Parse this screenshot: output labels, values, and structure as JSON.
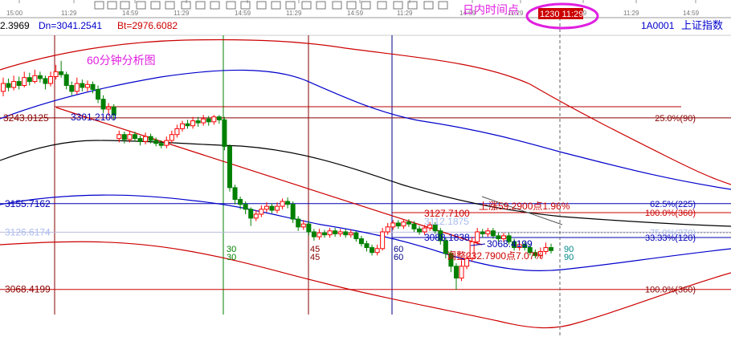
{
  "toolbar": {
    "time_labels": [
      "15:00",
      "11:29",
      "14:59",
      "11:29",
      "14:59",
      "11:29",
      "14:59",
      "11:29",
      "14:59",
      "11:29",
      "14:59",
      "11:29",
      "14:59"
    ],
    "intraday_label": "日内时间点",
    "cursor_time": "1230 11:29"
  },
  "header": {
    "indicator_text": "2.3969",
    "dn_text": "Dn=3041.2541",
    "bt_text": "Bt=2976.6082",
    "symbol_code": "1A0001",
    "symbol_name": "上证指数"
  },
  "chart_title": "60分钟分析图",
  "colors": {
    "up": "#ff0000",
    "down": "#008000",
    "outer_band": "#cc0000",
    "inner_band": "#0000cc",
    "mid_band": "#000000",
    "trendline": "#cc0000",
    "level_red": "#b40000",
    "level_blue": "#0000b4",
    "highlight": "#e020e0"
  },
  "chart_data": {
    "type": "candlestick",
    "title": "60分钟分析图",
    "symbol": "上证指数",
    "ylim": [
      3020,
      3345
    ],
    "price_labels": {
      "high": "3301.2100",
      "low_a": "3088.1838",
      "low_b": "3068.4199",
      "mid": "3127.7100",
      "mid2": "3112.1875"
    },
    "levels": [
      {
        "name": "3243.0125",
        "value": 3243.0125,
        "label": "25.0%(90)",
        "color": "red"
      },
      {
        "name": "3155.7162",
        "value": 3155.7162,
        "label": "62.5%(225)",
        "color": "blue"
      },
      {
        "name": "3126.6174",
        "value": 3126.6174,
        "label": "75.0%(270)",
        "color": "grey"
      },
      {
        "name": "3068.4199",
        "value": 3068.4199,
        "label": "100.0%(360)",
        "color": "red"
      }
    ],
    "right_labels": [
      "100.0%(360)",
      "33.33%(120)"
    ],
    "cycle_markers": [
      "30",
      "45",
      "60",
      "90"
    ],
    "annotations": {
      "rise": "上涨59.2900点1.96%",
      "correction": "调整232.7900点7.07%"
    },
    "candles": [
      {
        "o": 3270,
        "c": 3278,
        "h": 3284,
        "l": 3265
      },
      {
        "o": 3278,
        "c": 3274,
        "h": 3283,
        "l": 3270
      },
      {
        "o": 3274,
        "c": 3280,
        "h": 3286,
        "l": 3271
      },
      {
        "o": 3280,
        "c": 3276,
        "h": 3285,
        "l": 3272
      },
      {
        "o": 3276,
        "c": 3284,
        "h": 3290,
        "l": 3274
      },
      {
        "o": 3284,
        "c": 3280,
        "h": 3289,
        "l": 3276
      },
      {
        "o": 3280,
        "c": 3286,
        "h": 3292,
        "l": 3278
      },
      {
        "o": 3286,
        "c": 3283,
        "h": 3290,
        "l": 3279
      },
      {
        "o": 3283,
        "c": 3278,
        "h": 3286,
        "l": 3272
      },
      {
        "o": 3278,
        "c": 3285,
        "h": 3290,
        "l": 3275
      },
      {
        "o": 3285,
        "c": 3290,
        "h": 3297,
        "l": 3282
      },
      {
        "o": 3290,
        "c": 3287,
        "h": 3301,
        "l": 3284
      },
      {
        "o": 3287,
        "c": 3276,
        "h": 3290,
        "l": 3272
      },
      {
        "o": 3276,
        "c": 3270,
        "h": 3280,
        "l": 3266
      },
      {
        "o": 3270,
        "c": 3278,
        "h": 3284,
        "l": 3267
      },
      {
        "o": 3278,
        "c": 3274,
        "h": 3282,
        "l": 3270
      },
      {
        "o": 3274,
        "c": 3277,
        "h": 3281,
        "l": 3270
      },
      {
        "o": 3277,
        "c": 3272,
        "h": 3280,
        "l": 3268
      },
      {
        "o": 3272,
        "c": 3262,
        "h": 3276,
        "l": 3258
      },
      {
        "o": 3262,
        "c": 3252,
        "h": 3266,
        "l": 3248
      },
      {
        "o": 3252,
        "c": 3254,
        "h": 3258,
        "l": 3245
      },
      {
        "o": 3254,
        "c": 3246,
        "h": 3257,
        "l": 3241
      },
      {
        "o": 3222,
        "c": 3226,
        "h": 3230,
        "l": 3218
      },
      {
        "o": 3226,
        "c": 3221,
        "h": 3229,
        "l": 3217
      },
      {
        "o": 3221,
        "c": 3226,
        "h": 3230,
        "l": 3218
      },
      {
        "o": 3226,
        "c": 3222,
        "h": 3229,
        "l": 3219
      },
      {
        "o": 3222,
        "c": 3219,
        "h": 3225,
        "l": 3215
      },
      {
        "o": 3219,
        "c": 3224,
        "h": 3228,
        "l": 3216
      },
      {
        "o": 3224,
        "c": 3220,
        "h": 3227,
        "l": 3217
      },
      {
        "o": 3220,
        "c": 3217,
        "h": 3223,
        "l": 3214
      },
      {
        "o": 3217,
        "c": 3215,
        "h": 3220,
        "l": 3212
      },
      {
        "o": 3215,
        "c": 3220,
        "h": 3224,
        "l": 3212
      },
      {
        "o": 3220,
        "c": 3226,
        "h": 3230,
        "l": 3217
      },
      {
        "o": 3226,
        "c": 3232,
        "h": 3236,
        "l": 3223
      },
      {
        "o": 3232,
        "c": 3237,
        "h": 3240,
        "l": 3229
      },
      {
        "o": 3237,
        "c": 3235,
        "h": 3241,
        "l": 3232
      },
      {
        "o": 3235,
        "c": 3240,
        "h": 3244,
        "l": 3232
      },
      {
        "o": 3240,
        "c": 3238,
        "h": 3244,
        "l": 3234
      },
      {
        "o": 3238,
        "c": 3242,
        "h": 3246,
        "l": 3235
      },
      {
        "o": 3242,
        "c": 3239,
        "h": 3245,
        "l": 3235
      },
      {
        "o": 3239,
        "c": 3244,
        "h": 3246,
        "l": 3236
      },
      {
        "o": 3244,
        "c": 3241,
        "h": 3246,
        "l": 3237
      },
      {
        "o": 3241,
        "c": 3214,
        "h": 3244,
        "l": 3210
      },
      {
        "o": 3214,
        "c": 3172,
        "h": 3216,
        "l": 3168
      },
      {
        "o": 3172,
        "c": 3160,
        "h": 3175,
        "l": 3155
      },
      {
        "o": 3160,
        "c": 3155,
        "h": 3163,
        "l": 3150
      },
      {
        "o": 3155,
        "c": 3150,
        "h": 3158,
        "l": 3145
      },
      {
        "o": 3150,
        "c": 3141,
        "h": 3152,
        "l": 3133
      },
      {
        "o": 3141,
        "c": 3145,
        "h": 3149,
        "l": 3138
      },
      {
        "o": 3145,
        "c": 3150,
        "h": 3154,
        "l": 3142
      },
      {
        "o": 3150,
        "c": 3153,
        "h": 3157,
        "l": 3147
      },
      {
        "o": 3153,
        "c": 3149,
        "h": 3156,
        "l": 3146
      },
      {
        "o": 3149,
        "c": 3153,
        "h": 3157,
        "l": 3146
      },
      {
        "o": 3153,
        "c": 3158,
        "h": 3161,
        "l": 3150
      },
      {
        "o": 3158,
        "c": 3155,
        "h": 3162,
        "l": 3151
      },
      {
        "o": 3155,
        "c": 3140,
        "h": 3158,
        "l": 3136
      },
      {
        "o": 3140,
        "c": 3132,
        "h": 3143,
        "l": 3128
      },
      {
        "o": 3132,
        "c": 3135,
        "h": 3139,
        "l": 3129
      },
      {
        "o": 3135,
        "c": 3127,
        "h": 3138,
        "l": 3123
      },
      {
        "o": 3127,
        "c": 3122,
        "h": 3130,
        "l": 3118
      },
      {
        "o": 3122,
        "c": 3126,
        "h": 3130,
        "l": 3119
      },
      {
        "o": 3126,
        "c": 3124,
        "h": 3129,
        "l": 3121
      },
      {
        "o": 3124,
        "c": 3128,
        "h": 3131,
        "l": 3121
      },
      {
        "o": 3128,
        "c": 3125,
        "h": 3131,
        "l": 3122
      },
      {
        "o": 3125,
        "c": 3127,
        "h": 3130,
        "l": 3122
      },
      {
        "o": 3127,
        "c": 3124,
        "h": 3130,
        "l": 3121
      },
      {
        "o": 3124,
        "c": 3126,
        "h": 3129,
        "l": 3121
      },
      {
        "o": 3126,
        "c": 3120,
        "h": 3128,
        "l": 3117
      },
      {
        "o": 3120,
        "c": 3115,
        "h": 3123,
        "l": 3112
      },
      {
        "o": 3115,
        "c": 3111,
        "h": 3118,
        "l": 3107
      },
      {
        "o": 3111,
        "c": 3106,
        "h": 3114,
        "l": 3103
      },
      {
        "o": 3106,
        "c": 3110,
        "h": 3114,
        "l": 3103
      },
      {
        "o": 3110,
        "c": 3127,
        "h": 3131,
        "l": 3108
      },
      {
        "o": 3127,
        "c": 3132,
        "h": 3136,
        "l": 3124
      },
      {
        "o": 3132,
        "c": 3136,
        "h": 3139,
        "l": 3129
      },
      {
        "o": 3136,
        "c": 3133,
        "h": 3139,
        "l": 3130
      },
      {
        "o": 3133,
        "c": 3137,
        "h": 3140,
        "l": 3130
      },
      {
        "o": 3137,
        "c": 3135,
        "h": 3140,
        "l": 3132
      },
      {
        "o": 3135,
        "c": 3130,
        "h": 3138,
        "l": 3127
      },
      {
        "o": 3130,
        "c": 3127,
        "h": 3133,
        "l": 3124
      },
      {
        "o": 3127,
        "c": 3131,
        "h": 3134,
        "l": 3124
      },
      {
        "o": 3131,
        "c": 3134,
        "h": 3137,
        "l": 3128
      },
      {
        "o": 3134,
        "c": 3128,
        "h": 3137,
        "l": 3125
      },
      {
        "o": 3128,
        "c": 3118,
        "h": 3131,
        "l": 3114
      },
      {
        "o": 3118,
        "c": 3105,
        "h": 3121,
        "l": 3100
      },
      {
        "o": 3105,
        "c": 3092,
        "h": 3108,
        "l": 3086
      },
      {
        "o": 3092,
        "c": 3080,
        "h": 3095,
        "l": 3068
      },
      {
        "o": 3080,
        "c": 3092,
        "h": 3098,
        "l": 3077
      },
      {
        "o": 3092,
        "c": 3100,
        "h": 3105,
        "l": 3089
      },
      {
        "o": 3100,
        "c": 3117,
        "h": 3122,
        "l": 3097
      },
      {
        "o": 3117,
        "c": 3127,
        "h": 3131,
        "l": 3114
      },
      {
        "o": 3127,
        "c": 3125,
        "h": 3130,
        "l": 3121
      },
      {
        "o": 3125,
        "c": 3128,
        "h": 3131,
        "l": 3122
      },
      {
        "o": 3128,
        "c": 3123,
        "h": 3131,
        "l": 3120
      },
      {
        "o": 3123,
        "c": 3120,
        "h": 3126,
        "l": 3117
      },
      {
        "o": 3120,
        "c": 3123,
        "h": 3126,
        "l": 3117
      },
      {
        "o": 3123,
        "c": 3117,
        "h": 3126,
        "l": 3114
      },
      {
        "o": 3117,
        "c": 3111,
        "h": 3120,
        "l": 3108
      },
      {
        "o": 3111,
        "c": 3114,
        "h": 3118,
        "l": 3108
      },
      {
        "o": 3114,
        "c": 3111,
        "h": 3117,
        "l": 3108
      },
      {
        "o": 3111,
        "c": 3106,
        "h": 3114,
        "l": 3103
      },
      {
        "o": 3106,
        "c": 3103,
        "h": 3109,
        "l": 3100
      },
      {
        "o": 3103,
        "c": 3107,
        "h": 3111,
        "l": 3100
      },
      {
        "o": 3107,
        "c": 3111,
        "h": 3116,
        "l": 3104
      },
      {
        "o": 3111,
        "c": 3108,
        "h": 3115,
        "l": 3105
      }
    ]
  }
}
